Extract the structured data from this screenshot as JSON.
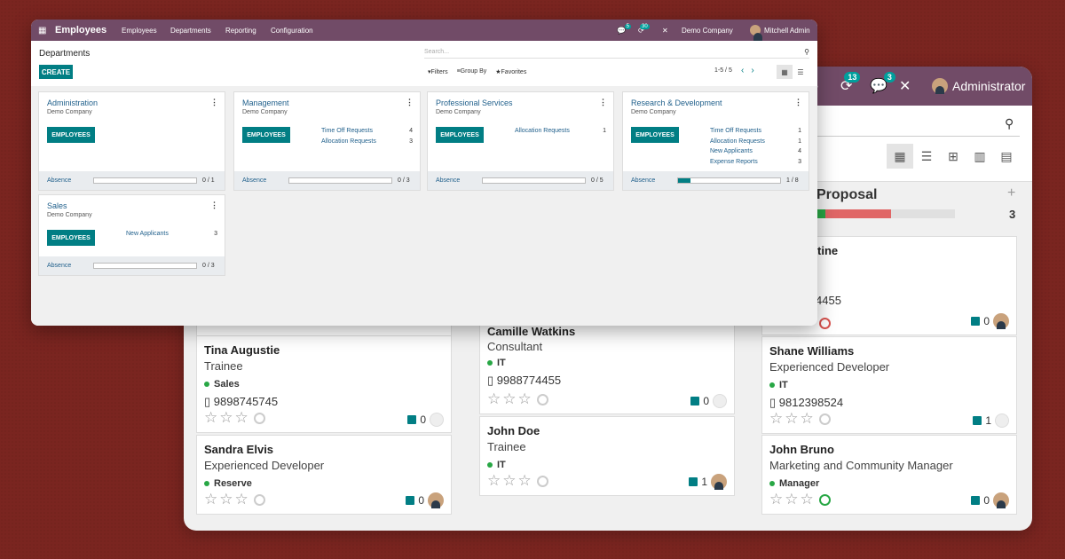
{
  "back": {
    "topbar": {
      "notif_count": "13",
      "chat_count": "3",
      "user": "Administrator"
    },
    "column": {
      "title": "Proposal",
      "count": "3"
    },
    "cards": [
      {
        "name": "",
        "job": "",
        "tag": "",
        "phone": "",
        "docs": ""
      },
      {
        "name": "Tina Augustie",
        "job": "Trainee",
        "tag": "Sales",
        "phone": "9898745745",
        "docs": "0"
      },
      {
        "name": "Sandra Elvis",
        "job": "Experienced Developer",
        "tag": "Reserve",
        "phone": "",
        "docs": "0"
      },
      {
        "name": "Camille Watkins",
        "job": "Consultant",
        "tag": "IT",
        "phone": "9988774455",
        "docs": "0"
      },
      {
        "name": "John Doe",
        "job": "Trainee",
        "tag": "IT",
        "phone": "",
        "docs": "1"
      },
      {
        "name": "tine",
        "job": "",
        "tag": "",
        "phone": "4455",
        "docs": "0"
      },
      {
        "name": "Shane Williams",
        "job": "Experienced Developer",
        "tag": "IT",
        "phone": "9812398524",
        "docs": "1"
      },
      {
        "name": "John Bruno",
        "job": "Marketing and Community Manager",
        "tag": "Manager",
        "phone": "",
        "docs": "0"
      }
    ]
  },
  "front": {
    "topbar": {
      "app": "Employees",
      "menu": [
        "Employees",
        "Departments",
        "Reporting",
        "Configuration"
      ],
      "chat_count": "5",
      "activity_count": "30",
      "company": "Demo Company",
      "user": "Mitchell Admin"
    },
    "title": "Departments",
    "create": "CREATE",
    "search_placeholder": "Search...",
    "filters": "Filters",
    "groupby": "Group By",
    "favorites": "Favorites",
    "pager": "1-5 / 5",
    "departments": [
      {
        "name": "Administration",
        "company": "Demo Company",
        "button": "EMPLOYEES",
        "stats": [],
        "absence": "Absence",
        "count": "0 / 1",
        "ratio": 0
      },
      {
        "name": "Management",
        "company": "Demo Company",
        "button": "EMPLOYEES",
        "stats": [
          {
            "label": "Time Off Requests",
            "value": "4"
          },
          {
            "label": "Allocation Requests",
            "value": "3"
          }
        ],
        "absence": "Absence",
        "count": "0 / 3",
        "ratio": 0
      },
      {
        "name": "Professional Services",
        "company": "Demo Company",
        "button": "EMPLOYEES",
        "stats": [
          {
            "label": "Allocation Requests",
            "value": "1"
          }
        ],
        "absence": "Absence",
        "count": "0 / 5",
        "ratio": 0
      },
      {
        "name": "Research & Development",
        "company": "Demo Company",
        "button": "EMPLOYEES",
        "stats": [
          {
            "label": "Time Off Requests",
            "value": "1"
          },
          {
            "label": "Allocation Requests",
            "value": "1"
          },
          {
            "label": "New Applicants",
            "value": "4"
          },
          {
            "label": "Expense Reports",
            "value": "3"
          }
        ],
        "absence": "Absence",
        "count": "1 / 8",
        "ratio": 0.125
      },
      {
        "name": "Sales",
        "company": "Demo Company",
        "button": "EMPLOYEES",
        "stats": [
          {
            "label": "New Applicants",
            "value": "3"
          }
        ],
        "absence": "Absence",
        "count": "0 / 3",
        "ratio": 0
      }
    ]
  }
}
